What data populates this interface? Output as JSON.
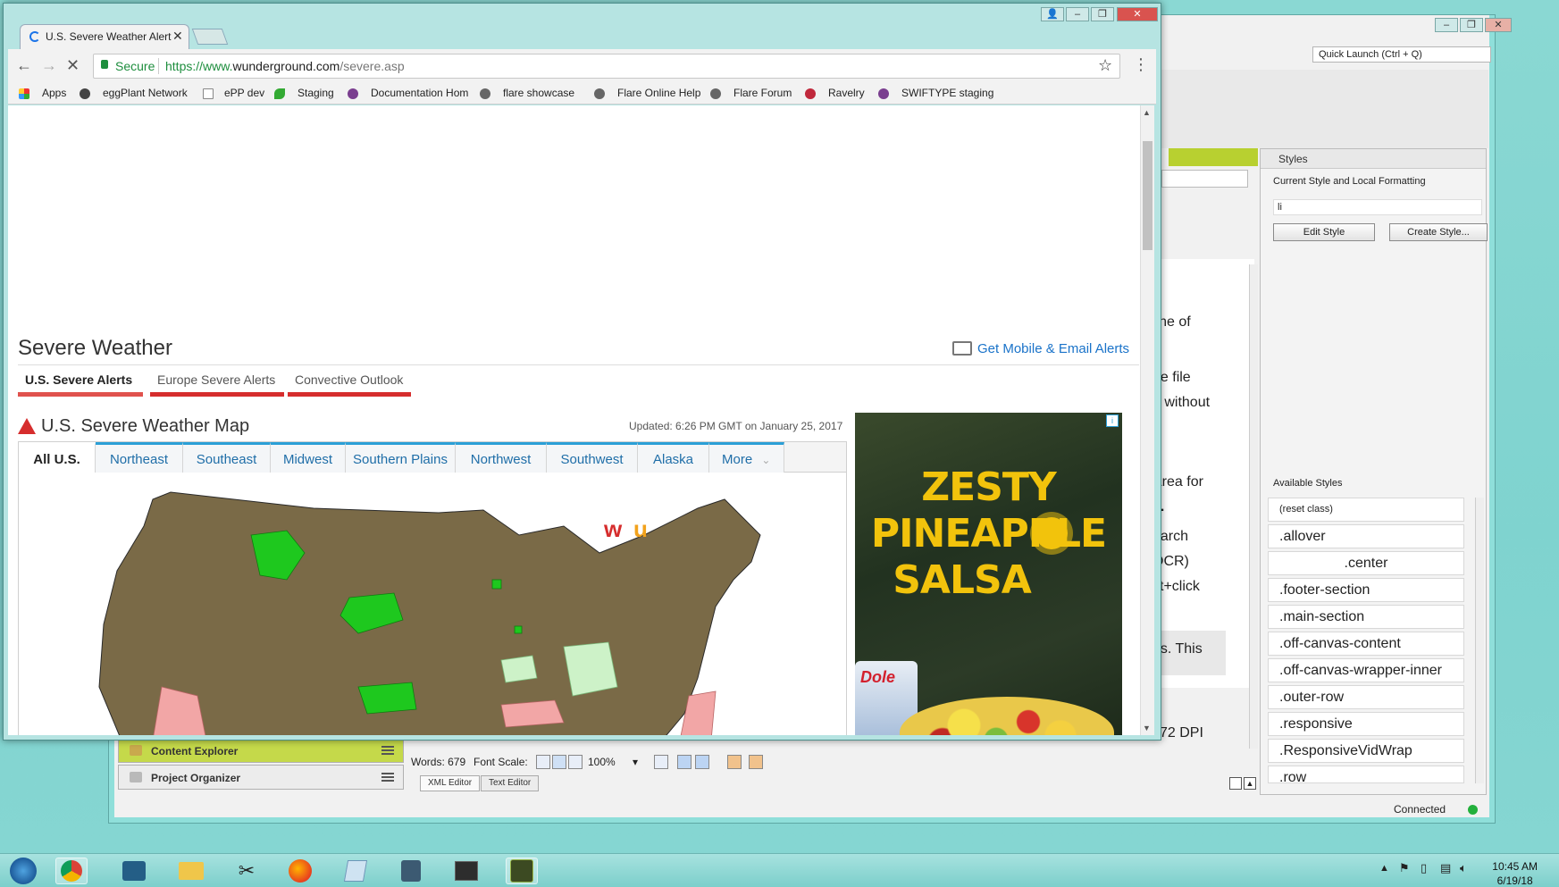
{
  "flare": {
    "quick_launch": "Quick Launch (Ctrl + Q)",
    "styles_panel": {
      "title": "Styles",
      "current_label": "Current Style and Local Formatting",
      "current_value": "li",
      "edit_button": "Edit Style",
      "create_button": "Create Style...",
      "available_label": "Available Styles",
      "items": [
        "(reset class)",
        ".allover",
        ".center",
        ".footer-section",
        ".main-section",
        ".off-canvas-content",
        ".off-canvas-wrapper-inner",
        ".outer-row",
        ".responsive",
        ".ResponsiveVidWrap",
        ".row"
      ]
    },
    "editor_fragments": [
      "line of",
      "he file",
      "e without",
      "Area for",
      "s.",
      "earch",
      "OCR)",
      "ift+click",
      "ns. This",
      "72 DPI"
    ],
    "left_panels": [
      "Content Explorer",
      "Project Organizer"
    ],
    "status": {
      "words": "Words: 679",
      "font_scale": "Font Scale:",
      "zoom": "100%"
    },
    "editor_tabs": [
      "XML Editor",
      "Text Editor"
    ],
    "connected": "Connected"
  },
  "chrome": {
    "tab_title": "U.S. Severe Weather Alert",
    "secure_label": "Secure",
    "url_prefix": "https://www.",
    "url_domain": "wunderground.com",
    "url_path": "/severe.asp",
    "bookmarks": [
      "Apps",
      "eggPlant Network",
      "ePP dev",
      "Staging",
      "Documentation Hom",
      "flare showcase",
      "Flare Online Help",
      "Flare Forum",
      "Ravelry",
      "SWIFTYPE staging"
    ]
  },
  "page": {
    "title": "Severe Weather",
    "mobile_alert": "Get Mobile & Email Alerts",
    "tabs": [
      "U.S. Severe Alerts",
      "Europe Severe Alerts",
      "Convective Outlook"
    ],
    "map_title": "U.S. Severe Weather Map",
    "updated": "Updated: 6:26 PM GMT on January 25, 2017",
    "regions": [
      "All U.S.",
      "Northeast",
      "Southeast",
      "Midwest",
      "Southern Plains",
      "Northwest",
      "Southwest",
      "Alaska",
      "More"
    ],
    "ad": {
      "headline_1": "ZESTY PINEAPPLE",
      "headline_2": "SALSA",
      "brand": "Dole"
    }
  },
  "taskbar": {
    "time": "10:45 AM",
    "date": "6/19/18"
  },
  "colors": {
    "accent_blue": "#1a73c9",
    "alert_red": "#d62d2d",
    "map_land": "#7a6a47",
    "map_green": "#1ec81e",
    "flare_green": "#b8d030"
  }
}
